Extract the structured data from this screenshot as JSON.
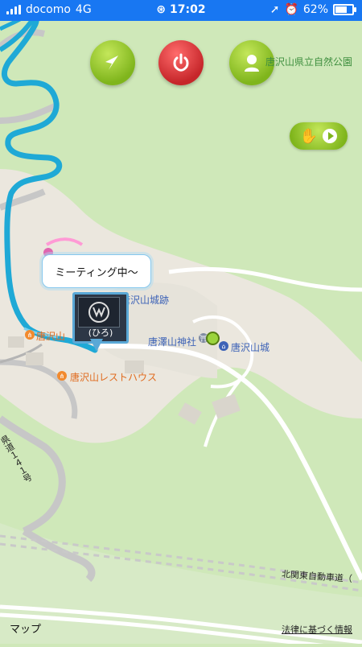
{
  "status": {
    "carrier": "docomo",
    "network": "4G",
    "time": "17:02",
    "battery": "62%",
    "battery_fraction": 0.62
  },
  "map": {
    "park_label": "唐沢山県立自然公園",
    "castle_ruins_label": "唐沢山城跡",
    "shrine_label": "唐澤山神社",
    "castle_label": "唐沢山城",
    "resthouse_label": "唐沢山レストハウス",
    "left_poi_label": "唐沢山",
    "road_left": "県道１４１号",
    "road_bottom": "北関東自動車道（",
    "attribution_brand": "マップ",
    "legal": "法律に基づく情報"
  },
  "bubble": {
    "text": "ミーティング中～"
  },
  "avatar": {
    "name": "(ひろ)"
  },
  "icons": {
    "navigate": "navigation-arrow-icon",
    "power": "power-icon",
    "profile": "profile-icon",
    "wave": "hand-wave-icon",
    "play": "play-icon",
    "apple": "apple-icon"
  },
  "colors": {
    "status_bar": "#1877f2",
    "route": "#1fa9d6",
    "map_bg": "#cfe8b9"
  }
}
